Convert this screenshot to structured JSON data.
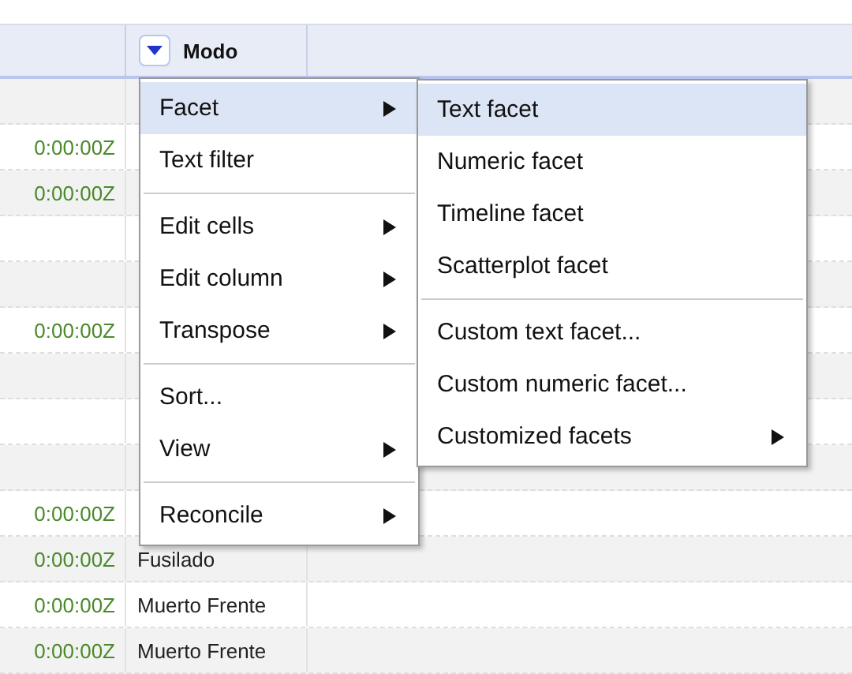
{
  "table": {
    "columns": [
      {
        "kind": "blank"
      },
      {
        "kind": "menu",
        "label": "Modo"
      },
      {
        "kind": "blank"
      }
    ],
    "rows": [
      {},
      {
        "column_1": "0:00:00Z"
      },
      {
        "column_1": "0:00:00Z"
      },
      {},
      {},
      {
        "column_1": "0:00:00Z"
      },
      {},
      {},
      {},
      {
        "column_1": "0:00:00Z"
      },
      {
        "column_1": "0:00:00Z",
        "modo": "Fusilado"
      },
      {
        "column_1": "0:00:00Z",
        "modo": "Muerto Frente"
      },
      {
        "column_1": "0:00:00Z",
        "modo": "Muerto Frente"
      }
    ]
  },
  "menu": {
    "items": [
      {
        "kind": "item",
        "label": "Facet",
        "submenu": true,
        "selected": true
      },
      {
        "kind": "item",
        "label": "Text filter",
        "submenu": false,
        "selected": false
      },
      {
        "kind": "separator"
      },
      {
        "kind": "item",
        "label": "Edit cells",
        "submenu": true,
        "selected": false
      },
      {
        "kind": "item",
        "label": "Edit column",
        "submenu": true,
        "selected": false
      },
      {
        "kind": "item",
        "label": "Transpose",
        "submenu": true,
        "selected": false
      },
      {
        "kind": "separator"
      },
      {
        "kind": "item",
        "label": "Sort...",
        "submenu": false,
        "selected": false
      },
      {
        "kind": "item",
        "label": "View",
        "submenu": true,
        "selected": false
      },
      {
        "kind": "separator"
      },
      {
        "kind": "item",
        "label": "Reconcile",
        "submenu": true,
        "selected": false
      }
    ]
  },
  "submenu": {
    "items": [
      {
        "kind": "item",
        "label": "Text facet",
        "submenu": false,
        "selected": true
      },
      {
        "kind": "item",
        "label": "Numeric facet",
        "submenu": false,
        "selected": false
      },
      {
        "kind": "item",
        "label": "Timeline facet",
        "submenu": false,
        "selected": false
      },
      {
        "kind": "item",
        "label": "Scatterplot facet",
        "submenu": false,
        "selected": false
      },
      {
        "kind": "separator"
      },
      {
        "kind": "item",
        "label": "Custom text facet...",
        "submenu": false,
        "selected": false
      },
      {
        "kind": "item",
        "label": "Custom numeric facet...",
        "submenu": false,
        "selected": false
      },
      {
        "kind": "item",
        "label": "Customized facets",
        "submenu": true,
        "selected": false
      }
    ]
  }
}
